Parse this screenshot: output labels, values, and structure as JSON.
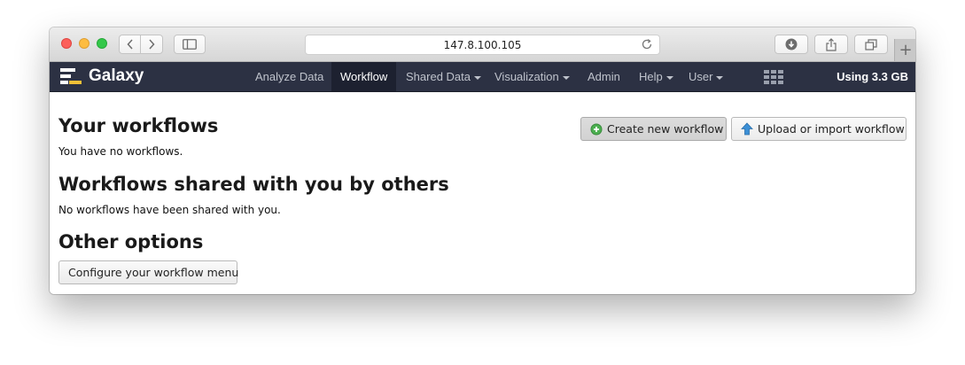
{
  "browser": {
    "url": "147.8.100.105"
  },
  "masthead": {
    "brand": "Galaxy",
    "nav": [
      {
        "label": "Analyze Data",
        "active": false,
        "dropdown": false
      },
      {
        "label": "Workflow",
        "active": true,
        "dropdown": false
      },
      {
        "label": "Shared Data",
        "active": false,
        "dropdown": true
      },
      {
        "label": "Visualization",
        "active": false,
        "dropdown": true
      },
      {
        "label": "Admin",
        "active": false,
        "dropdown": false
      },
      {
        "label": "Help",
        "active": false,
        "dropdown": true
      },
      {
        "label": "User",
        "active": false,
        "dropdown": true
      }
    ],
    "quota": "Using 3.3 GB"
  },
  "main": {
    "your_workflows_title": "Your workflows",
    "no_workflows_text": "You have no workflows.",
    "shared_title": "Workflows shared with you by others",
    "no_shared_text": "No workflows have been shared with you.",
    "other_options_title": "Other options",
    "configure_button": "Configure your workflow menu",
    "create_button": "Create new workflow",
    "upload_button": "Upload or import workflow"
  },
  "colors": {
    "masthead_bg": "#2c3143",
    "masthead_active_bg": "#1d2130",
    "create_icon": "#4caf50",
    "upload_icon": "#3b8fd6"
  },
  "icons": {
    "create_button": "plus-circle-icon",
    "upload_button": "arrow-up-icon",
    "apps": "grid-icon"
  }
}
